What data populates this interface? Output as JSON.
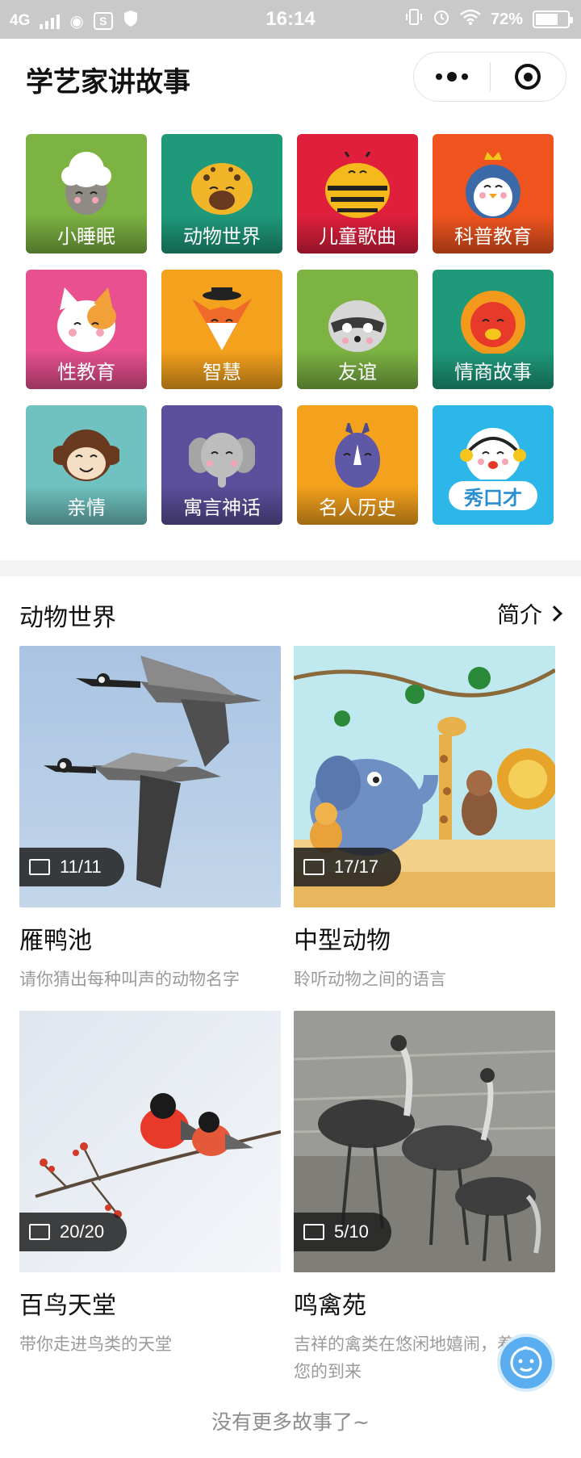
{
  "status_bar": {
    "network": "4G",
    "time": "16:14",
    "battery": "72%",
    "battery_level": 0.72
  },
  "nav": {
    "title": "学艺家讲故事",
    "more_icon": "more-dots-icon",
    "close_icon": "target-circle-icon"
  },
  "categories": [
    {
      "label": "小睡眠",
      "bg": "#7cb342",
      "face": "sheep"
    },
    {
      "label": "动物世界",
      "bg": "#1e9a7a",
      "face": "leopard"
    },
    {
      "label": "儿童歌曲",
      "bg": "#e01f3d",
      "face": "bee"
    },
    {
      "label": "科普教育",
      "bg": "#f0541e",
      "face": "penguin"
    },
    {
      "label": "性教育",
      "bg": "#e8508f",
      "face": "cat"
    },
    {
      "label": "智慧",
      "bg": "#f4a11d",
      "face": "fox"
    },
    {
      "label": "友谊",
      "bg": "#7cb342",
      "face": "raccoon"
    },
    {
      "label": "情商故事",
      "bg": "#1e9a7a",
      "face": "lion"
    },
    {
      "label": "亲情",
      "bg": "#6fc2c0",
      "face": "monkey"
    },
    {
      "label": "寓言神话",
      "bg": "#5c4f9b",
      "face": "elephant"
    },
    {
      "label": "名人历史",
      "bg": "#f4a11d",
      "face": "rhino"
    },
    {
      "label": "秀口才",
      "bg": "#2cb7e8",
      "face": "mascot"
    }
  ],
  "section": {
    "title": "动物世界",
    "link_label": "简介"
  },
  "cards": [
    {
      "title": "雁鸭池",
      "desc": "请你猜出每种叫声的动物名字",
      "count": "11/11"
    },
    {
      "title": "中型动物",
      "desc": "聆听动物之间的语言",
      "count": "17/17"
    },
    {
      "title": "百鸟天堂",
      "desc": "带你走进鸟类的天堂",
      "count": "20/20"
    },
    {
      "title": "鸣禽苑",
      "desc": "吉祥的禽类在悠闲地嬉闹，着您的到来",
      "count": "5/10"
    }
  ],
  "footer": {
    "text": "没有更多故事了~"
  },
  "colors": {
    "accent": "#5aaef0",
    "status_bar": "#c9c9c9",
    "divider": "#f3f3f3"
  }
}
